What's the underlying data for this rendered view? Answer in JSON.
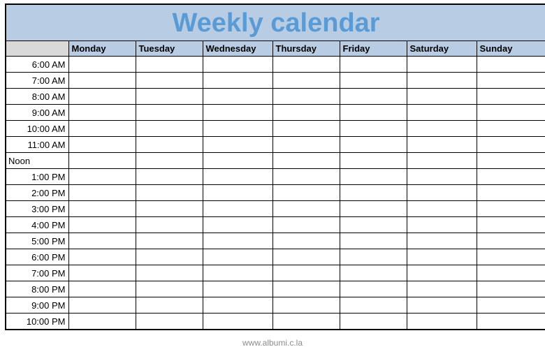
{
  "document": {
    "title": "Weekly calendar",
    "title_color": "#5b9bd5",
    "title_band_color": "#b8cce4"
  },
  "table": {
    "corner_header": "",
    "corner_color": "#d9d9d9",
    "header_color": "#b8cce4",
    "grid_color": "#000000",
    "day_headers": [
      "Monday",
      "Tuesday",
      "Wednesday",
      "Thursday",
      "Friday",
      "Saturday",
      "Sunday"
    ],
    "time_slots": [
      "6:00 AM",
      "7:00 AM",
      "8:00 AM",
      "9:00 AM",
      "10:00 AM",
      "11:00 AM",
      "Noon",
      "1:00 PM",
      "2:00 PM",
      "3:00 PM",
      "4:00 PM",
      "5:00 PM",
      "6:00 PM",
      "7:00 PM",
      "8:00 PM",
      "9:00 PM",
      "10:00 PM"
    ],
    "cells": [
      [
        "",
        "",
        "",
        "",
        "",
        "",
        ""
      ],
      [
        "",
        "",
        "",
        "",
        "",
        "",
        ""
      ],
      [
        "",
        "",
        "",
        "",
        "",
        "",
        ""
      ],
      [
        "",
        "",
        "",
        "",
        "",
        "",
        ""
      ],
      [
        "",
        "",
        "",
        "",
        "",
        "",
        ""
      ],
      [
        "",
        "",
        "",
        "",
        "",
        "",
        ""
      ],
      [
        "",
        "",
        "",
        "",
        "",
        "",
        ""
      ],
      [
        "",
        "",
        "",
        "",
        "",
        "",
        ""
      ],
      [
        "",
        "",
        "",
        "",
        "",
        "",
        ""
      ],
      [
        "",
        "",
        "",
        "",
        "",
        "",
        ""
      ],
      [
        "",
        "",
        "",
        "",
        "",
        "",
        ""
      ],
      [
        "",
        "",
        "",
        "",
        "",
        "",
        ""
      ],
      [
        "",
        "",
        "",
        "",
        "",
        "",
        ""
      ],
      [
        "",
        "",
        "",
        "",
        "",
        "",
        ""
      ],
      [
        "",
        "",
        "",
        "",
        "",
        "",
        ""
      ],
      [
        "",
        "",
        "",
        "",
        "",
        "",
        ""
      ],
      [
        "",
        "",
        "",
        "",
        "",
        "",
        ""
      ]
    ]
  },
  "footer": {
    "text": "www.albumi.c.la",
    "color": "#8c8c8c"
  }
}
